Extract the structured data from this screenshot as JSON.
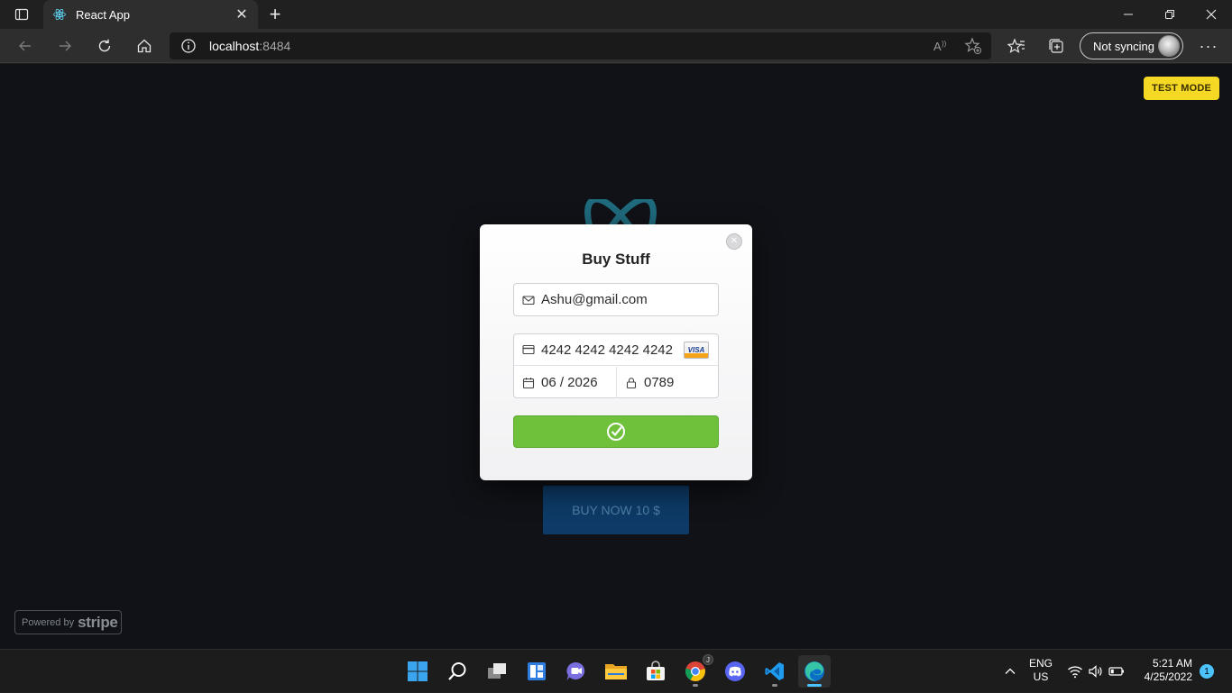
{
  "browser": {
    "tab_title": "React App",
    "tab_close_glyph": "✕",
    "new_tab_glyph": "+",
    "url_host": "localhost",
    "url_port": ":8484",
    "profile_label": "Not syncing",
    "more_glyph": "···"
  },
  "page": {
    "test_mode_label": "TEST MODE",
    "buy_button_label": "BUY NOW 10 $",
    "powered_by_label": "Powered by",
    "powered_by_brand": "stripe"
  },
  "checkout": {
    "title": "Buy Stuff",
    "close_glyph": "✕",
    "email_value": "Ashu@gmail.com",
    "card_number": "4242 4242 4242 4242",
    "card_brand": "VISA",
    "expiry": "06 / 2026",
    "cvc": "0789",
    "pay_button_color": "#6fc03b"
  },
  "taskbar": {
    "apps": [
      "start-icon",
      "search-icon",
      "task-view-icon",
      "widgets-icon",
      "teams-chat-icon",
      "file-explorer-icon",
      "store-icon",
      "chrome-icon",
      "discord-icon",
      "vscode-icon",
      "edge-icon"
    ],
    "chrome_badge": "J",
    "lang_line1": "ENG",
    "lang_line2": "US",
    "time": "5:21 AM",
    "date": "4/25/2022",
    "notifications": "1"
  },
  "colors": {
    "accent": "#4cc2ff",
    "test_badge": "#f5d824",
    "page_bg": "#101217"
  }
}
